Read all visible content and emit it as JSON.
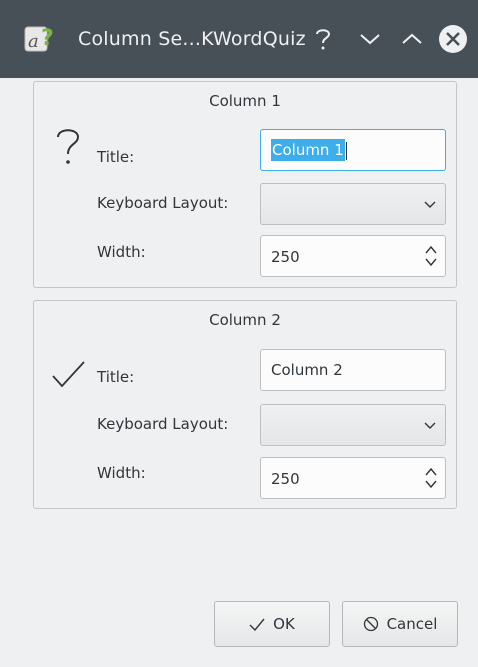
{
  "window": {
    "title": "Column Se...KWordQuiz",
    "icon": "kwordquiz-app-icon",
    "controls": [
      "help-icon",
      "minimize-icon",
      "maximize-icon",
      "close-icon"
    ]
  },
  "groups": [
    {
      "title": "Column 1",
      "status_icon": "question-mark-icon",
      "title_label": "Title:",
      "title_value": "Column 1",
      "title_selected": true,
      "layout_label": "Keyboard Layout:",
      "layout_value": "",
      "width_label": "Width:",
      "width_value": "250"
    },
    {
      "title": "Column 2",
      "status_icon": "checkmark-icon",
      "title_label": "Title:",
      "title_value": "Column 2",
      "title_selected": false,
      "layout_label": "Keyboard Layout:",
      "layout_value": "",
      "width_label": "Width:",
      "width_value": "250"
    }
  ],
  "buttons": {
    "ok_label": "OK",
    "ok_icon": "checkmark-icon",
    "cancel_label": "Cancel",
    "cancel_icon": "cancel-icon"
  },
  "colors": {
    "titlebar": "#475057",
    "selection": "#3daee9",
    "window_bg": "#eff0f1"
  }
}
